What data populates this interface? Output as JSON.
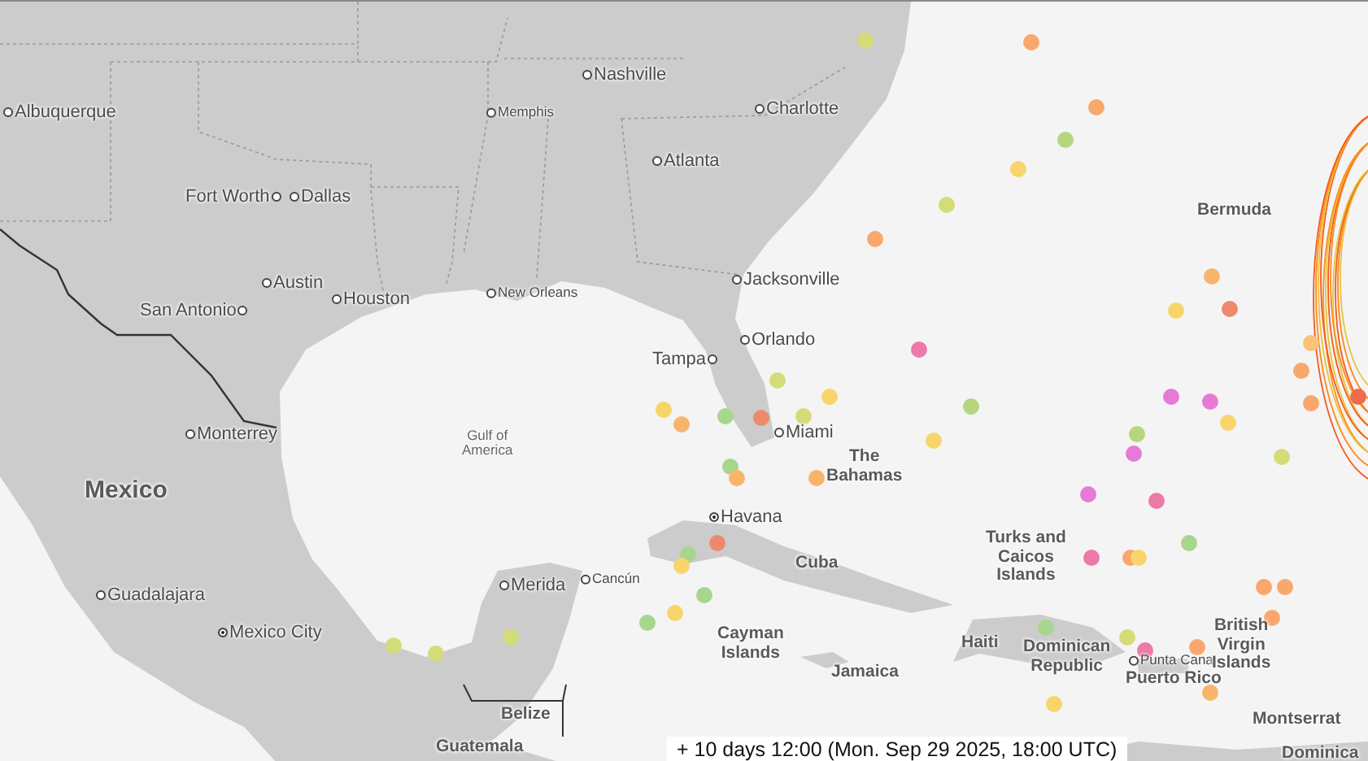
{
  "map": {
    "labels": [
      {
        "text": "Albuquerque",
        "kind": "city"
      },
      {
        "text": "Nashville",
        "kind": "city"
      },
      {
        "text": "Memphis",
        "kind": "city_small"
      },
      {
        "text": "Charlotte",
        "kind": "city"
      },
      {
        "text": "Atlanta",
        "kind": "city"
      },
      {
        "text": "Fort Worth",
        "kind": "city"
      },
      {
        "text": "Dallas",
        "kind": "city"
      },
      {
        "text": "Bermuda",
        "kind": "region"
      },
      {
        "text": "Austin",
        "kind": "city"
      },
      {
        "text": "Houston",
        "kind": "city"
      },
      {
        "text": "San Antonio",
        "kind": "city"
      },
      {
        "text": "New Orleans",
        "kind": "city_small"
      },
      {
        "text": "Jacksonville",
        "kind": "city"
      },
      {
        "text": "Tampa",
        "kind": "city"
      },
      {
        "text": "Orlando",
        "kind": "city"
      },
      {
        "text": "Miami",
        "kind": "city"
      },
      {
        "text": "The\nBahamas",
        "kind": "region"
      },
      {
        "text": "Monterrey",
        "kind": "city"
      },
      {
        "text": "Gulf of\nAmerica",
        "kind": "water"
      },
      {
        "text": "Mexico",
        "kind": "country"
      },
      {
        "text": "Havana",
        "kind": "capital"
      },
      {
        "text": "Cuba",
        "kind": "region"
      },
      {
        "text": "Turks and\nCaicos\nIslands",
        "kind": "region"
      },
      {
        "text": "Merida",
        "kind": "city"
      },
      {
        "text": "Cancún",
        "kind": "city_small"
      },
      {
        "text": "Guadalajara",
        "kind": "city"
      },
      {
        "text": "Mexico City",
        "kind": "capital"
      },
      {
        "text": "Cayman\nIslands",
        "kind": "region"
      },
      {
        "text": "Haiti",
        "kind": "region"
      },
      {
        "text": "Dominican\nRepublic",
        "kind": "region"
      },
      {
        "text": "Punta Cana",
        "kind": "city_small"
      },
      {
        "text": "Puerto Rico",
        "kind": "region"
      },
      {
        "text": "British\nVirgin\nIslands",
        "kind": "region"
      },
      {
        "text": "Jamaica",
        "kind": "region"
      },
      {
        "text": "Belize",
        "kind": "region"
      },
      {
        "text": "Montserrat",
        "kind": "region"
      },
      {
        "text": "Guatemala",
        "kind": "region"
      },
      {
        "text": "Dominica",
        "kind": "region"
      }
    ],
    "forecast_points": [
      {
        "color": "#d4dc7a"
      },
      {
        "color": "#f9a76c"
      },
      {
        "color": "#f9a76c"
      },
      {
        "color": "#b5d67e"
      },
      {
        "color": "#f7d56b"
      },
      {
        "color": "#d4dc7a"
      },
      {
        "color": "#f9a76c"
      },
      {
        "color": "#f9b46c"
      },
      {
        "color": "#f7d56b"
      },
      {
        "color": "#ee8a6b"
      },
      {
        "color": "#fbc27a"
      },
      {
        "color": "#f9a76c"
      },
      {
        "color": "#ec79a8"
      },
      {
        "color": "#d4dc7a"
      },
      {
        "color": "#f7d56b"
      },
      {
        "color": "#f7d56b"
      },
      {
        "color": "#f9b46c"
      },
      {
        "color": "#a7d68f"
      },
      {
        "color": "#ee8a6b"
      },
      {
        "color": "#d4dc7a"
      },
      {
        "color": "#b5d67e"
      },
      {
        "color": "#e77ad6"
      },
      {
        "color": "#e77ad6"
      },
      {
        "color": "#f7d56b"
      },
      {
        "color": "#f9a76c"
      },
      {
        "color": "#b5d67e"
      },
      {
        "color": "#e77ad6"
      },
      {
        "color": "#f7d56b"
      },
      {
        "color": "#d4dc7a"
      },
      {
        "color": "#a7d68f"
      },
      {
        "color": "#f9b46c"
      },
      {
        "color": "#f9b46c"
      },
      {
        "color": "#e77ad6"
      },
      {
        "color": "#ec79a8"
      },
      {
        "color": "#a7d68f"
      },
      {
        "color": "#ec79a8"
      },
      {
        "color": "#f9a76c"
      },
      {
        "color": "#f7d56b"
      },
      {
        "color": "#ee8a6b"
      },
      {
        "color": "#a7d68f"
      },
      {
        "color": "#f7d56b"
      },
      {
        "color": "#a7d68f"
      },
      {
        "color": "#f7d56b"
      },
      {
        "color": "#a7d68f"
      },
      {
        "color": "#f9a76c"
      },
      {
        "color": "#f9a76c"
      },
      {
        "color": "#f9a76c"
      },
      {
        "color": "#a7d68f"
      },
      {
        "color": "#d4dc7a"
      },
      {
        "color": "#ec79a8"
      },
      {
        "color": "#f9a76c"
      },
      {
        "color": "#f9b46c"
      },
      {
        "color": "#f7d56b"
      },
      {
        "color": "#d4dc7a"
      },
      {
        "color": "#d4dc7a"
      },
      {
        "color": "#d4dc7a"
      },
      {
        "color": "#ee6b4d"
      }
    ]
  },
  "time_label": "+ 10 days 12:00  (Mon. Sep 29 2025, 18:00 UTC)"
}
